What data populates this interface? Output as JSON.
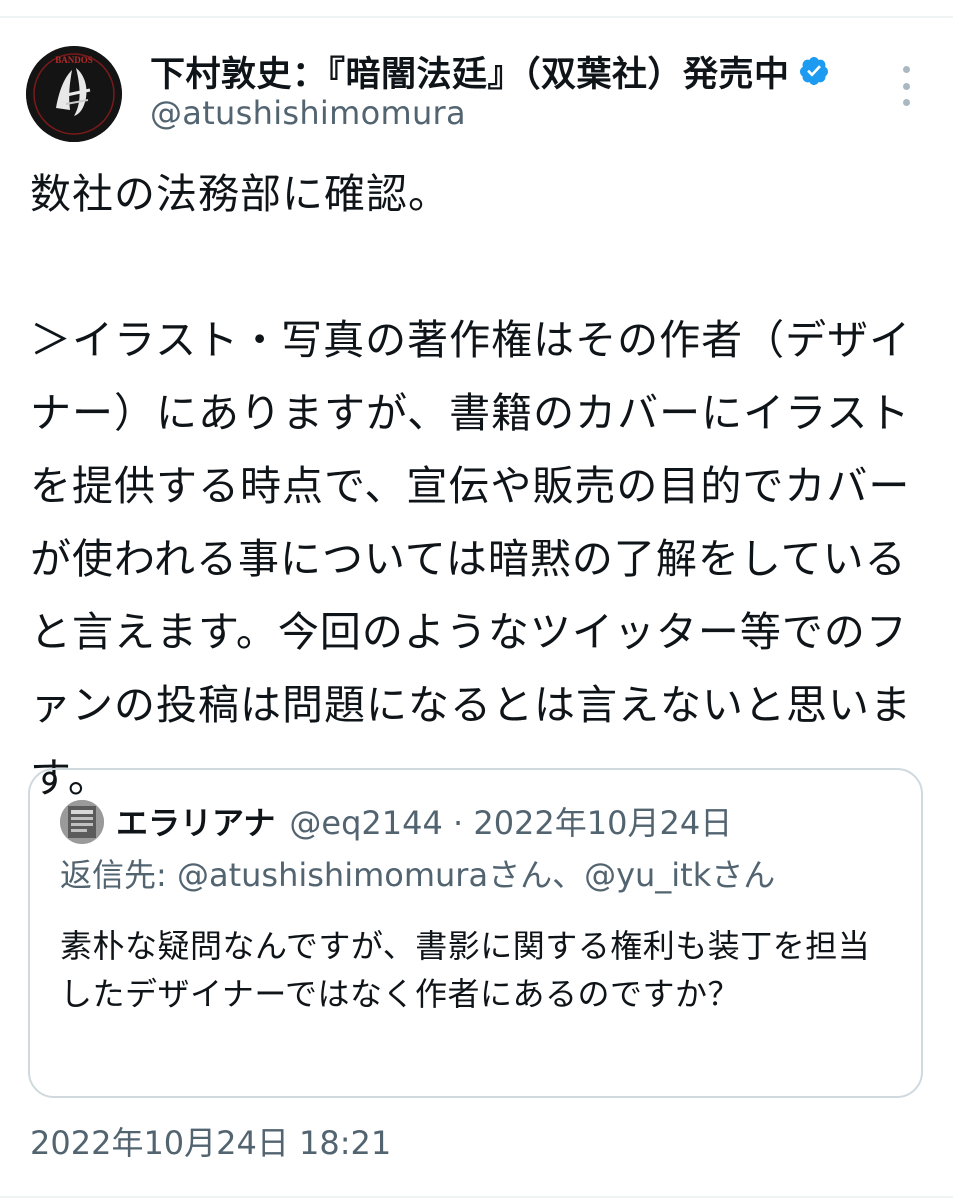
{
  "tweet": {
    "author_name": "下村敦史：『暗闇法廷』（双葉社）発売中",
    "author_handle": "@atushishimomura",
    "verified": true,
    "avatar_text": "BANDOS",
    "body": "数社の法務部に確認。\n\n＞イラスト・写真の著作権はその作者（デザイナー）にありますが、書籍のカバーにイラストを提供する時点で、宣伝や販売の目的でカバーが使われる事については暗黙の了解をしていると言えます。今回のようなツイッター等でのファンの投稿は問題になるとは言えないと思います。",
    "timestamp": "2022年10月24日 18:21"
  },
  "quoted_tweet": {
    "author_name": "エラリアナ",
    "meta": "@eq2144 · 2022年10月24日",
    "reply_prefix": "返信先: ",
    "reply_mentions": "@atushishimomuraさん、@yu_itkさん",
    "body": "素朴な疑問なんですが、書影に関する権利も装丁を担当したデザイナーではなく作者にあるのですか？"
  },
  "colors": {
    "text_primary": "#0f1419",
    "text_secondary": "#536471",
    "verified_blue": "#1d9bf0",
    "border": "#cfd9de"
  },
  "icons": {
    "verified": "verified-badge-icon",
    "more": "more-options-icon"
  }
}
